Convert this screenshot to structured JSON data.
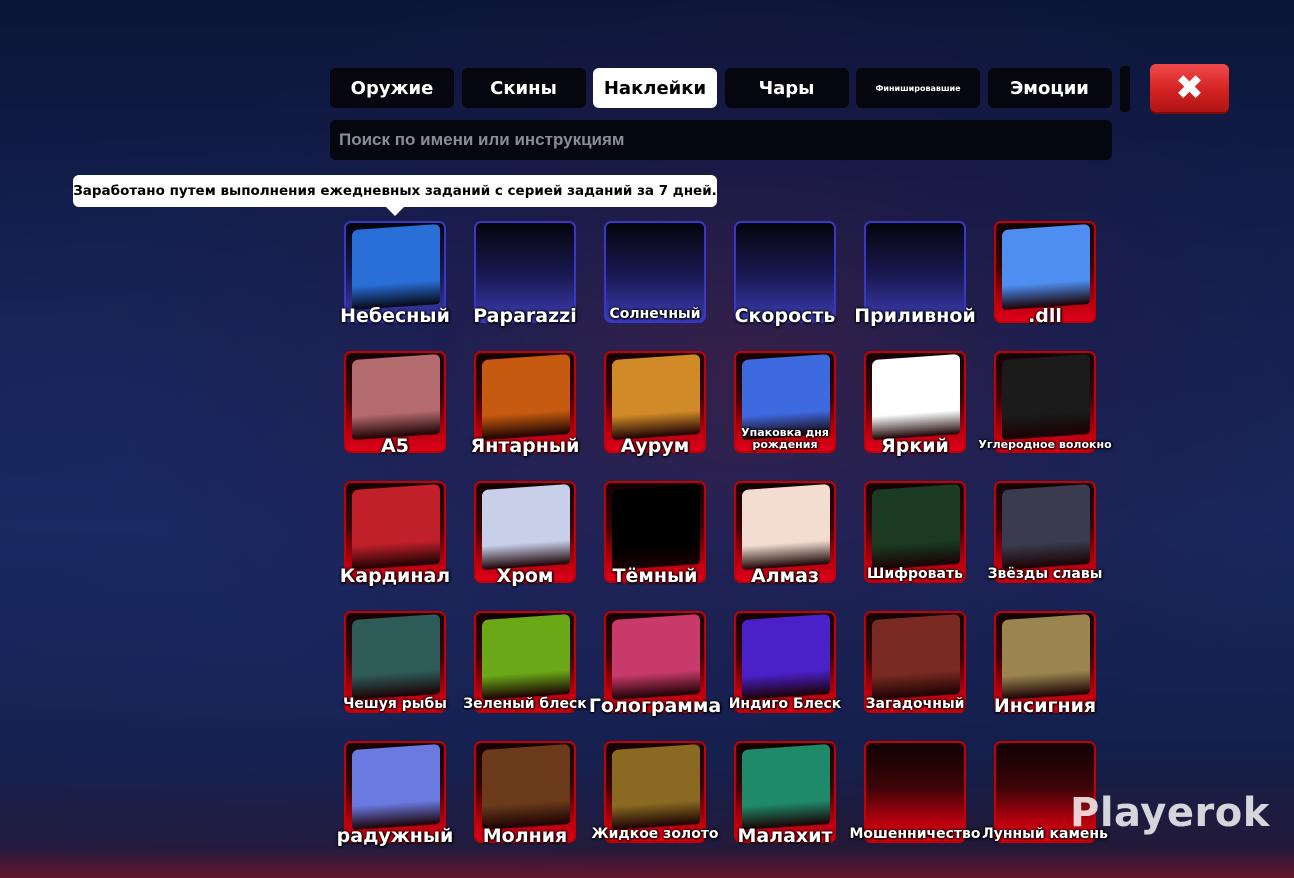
{
  "tabs": [
    {
      "label": "Оружие",
      "active": false
    },
    {
      "label": "Скины",
      "active": false
    },
    {
      "label": "Наклейки",
      "active": true
    },
    {
      "label": "Чары",
      "active": false
    },
    {
      "label": "Финишировавшие",
      "active": false
    },
    {
      "label": "Эмоции",
      "active": false
    }
  ],
  "close_icon": "close-x-icon",
  "search": {
    "placeholder": "Поиск по имени или инструкциям",
    "value": ""
  },
  "tooltip": "Заработано путем выполнения ежедневных заданий с серией заданий за 7 дней.",
  "items": [
    {
      "label": "Небесный",
      "frame": "blue",
      "swatch": "#2a6fd8"
    },
    {
      "label": "Paparazzi",
      "frame": "blue",
      "swatch": ""
    },
    {
      "label": "Солнечный",
      "frame": "blue",
      "swatch": ""
    },
    {
      "label": "Скорость",
      "frame": "blue",
      "swatch": ""
    },
    {
      "label": "Приливной",
      "frame": "blue",
      "swatch": ""
    },
    {
      "label": ".dll",
      "frame": "red",
      "swatch": "#4d8ef0"
    },
    {
      "label": "A5",
      "frame": "red",
      "swatch": "#b46b6e"
    },
    {
      "label": "Янтарный",
      "frame": "red",
      "swatch": "#c55a10"
    },
    {
      "label": "Аурум",
      "frame": "red",
      "swatch": "#d08a28"
    },
    {
      "label": "Упаковка дня рождения",
      "frame": "red",
      "swatch": "#3e6ae0"
    },
    {
      "label": "Яркий",
      "frame": "red",
      "swatch": "#ffffff"
    },
    {
      "label": "Углеродное волокно",
      "frame": "red",
      "swatch": "#1b1b1b"
    },
    {
      "label": "Кардинал",
      "frame": "red",
      "swatch": "#c0202a"
    },
    {
      "label": "Хром",
      "frame": "red",
      "swatch": "#c8cfe8"
    },
    {
      "label": "Тёмный",
      "frame": "red",
      "swatch": "#000000"
    },
    {
      "label": "Алмаз",
      "frame": "red",
      "swatch": "#f2ddd0"
    },
    {
      "label": "Шифровать",
      "frame": "red",
      "swatch": "#1a3a22"
    },
    {
      "label": "Звёзды славы",
      "frame": "red",
      "swatch": "#3a3b4e"
    },
    {
      "label": "Чешуя рыбы",
      "frame": "red",
      "swatch": "#2e5a58"
    },
    {
      "label": "Зеленый блеск",
      "frame": "red",
      "swatch": "#6aa818"
    },
    {
      "label": "Голограмма",
      "frame": "red",
      "swatch": "#c83a6a"
    },
    {
      "label": "Индиго Блеск",
      "frame": "red",
      "swatch": "#4a20c8"
    },
    {
      "label": "Загадочный",
      "frame": "red",
      "swatch": "#7a2a22"
    },
    {
      "label": "Инсигния",
      "frame": "red",
      "swatch": "#9a8550"
    },
    {
      "label": "радужный",
      "frame": "red",
      "swatch": "#6a7ae0"
    },
    {
      "label": "Молния",
      "frame": "red",
      "swatch": "#6a3a1a"
    },
    {
      "label": "Жидкое золото",
      "frame": "red",
      "swatch": "#8a6a22"
    },
    {
      "label": "Малахит",
      "frame": "red",
      "swatch": "#1f8a6a"
    },
    {
      "label": "Мошенничество",
      "frame": "red",
      "swatch": ""
    },
    {
      "label": "Лунный камень",
      "frame": "red",
      "swatch": ""
    }
  ],
  "watermark": "Playerok"
}
